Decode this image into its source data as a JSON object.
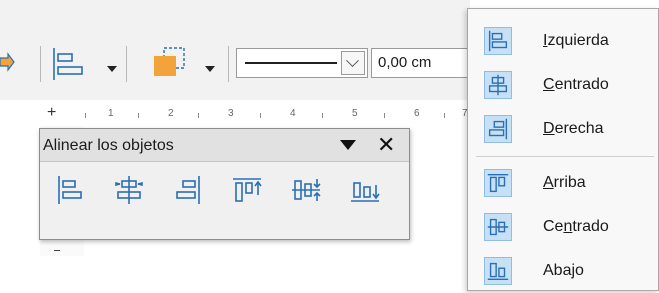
{
  "toolbar": {
    "line_width_value": "0,00 cm",
    "icons": [
      "arrange-icon",
      "align-objects-icon",
      "dropdown-arrow-icon",
      "shadow-icon",
      "dropdown-arrow-icon",
      "line-style-dropdown",
      "chevron-down-icon"
    ]
  },
  "ruler": {
    "labels": [
      "1",
      "2",
      "3",
      "4",
      "5",
      "6",
      "7"
    ]
  },
  "align_panel": {
    "title": "Alinear los objetos",
    "buttons": [
      {
        "name": "align-left-button",
        "icon": "align-left-icon"
      },
      {
        "name": "align-center-button",
        "icon": "align-center-icon"
      },
      {
        "name": "align-right-button",
        "icon": "align-right-icon"
      },
      {
        "name": "align-top-button",
        "icon": "align-top-icon"
      },
      {
        "name": "align-middle-button",
        "icon": "align-middle-icon"
      },
      {
        "name": "align-bottom-button",
        "icon": "align-bottom-icon"
      }
    ]
  },
  "align_menu": {
    "items": [
      {
        "pre": "",
        "key": "I",
        "post": "zquierda",
        "icon": "align-left-icon"
      },
      {
        "pre": "",
        "key": "C",
        "post": "entrado",
        "icon": "align-center-icon"
      },
      {
        "pre": "",
        "key": "D",
        "post": "erecha",
        "icon": "align-right-icon"
      },
      {
        "pre": "",
        "key": "A",
        "post": "rriba",
        "icon": "align-top-icon"
      },
      {
        "pre": "Ce",
        "key": "n",
        "post": "trado",
        "icon": "align-middle-icon"
      },
      {
        "pre": "Aba",
        "key": "j",
        "post": "o",
        "icon": "align-bottom-icon"
      }
    ]
  },
  "colors": {
    "icon_blue": "#2a6fb5",
    "menu_icon_bg": "#c6e0f6",
    "shadow_orange": "#f2a33a"
  }
}
